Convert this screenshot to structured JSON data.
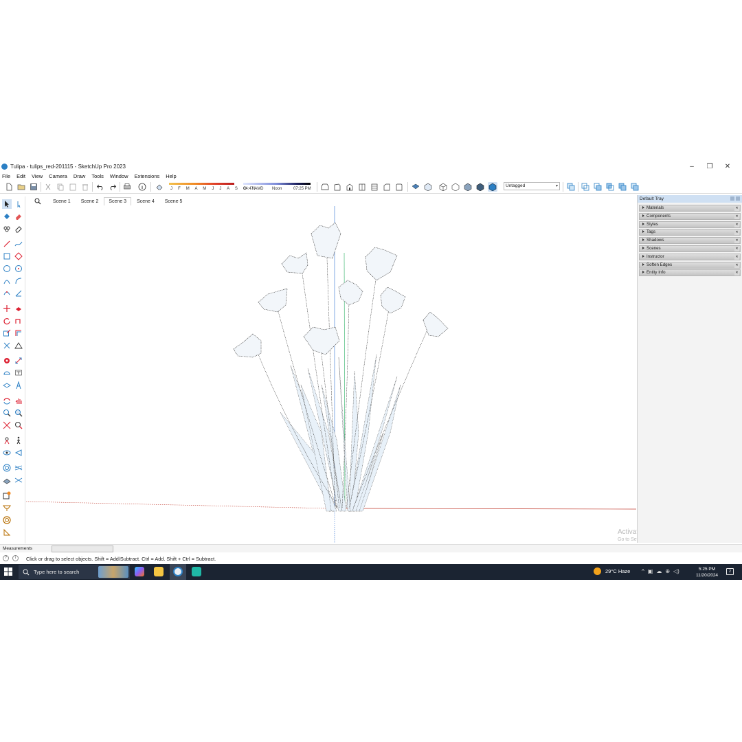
{
  "window": {
    "title": "Tulipa - tulips_red-201115 - SketchUp Pro 2023",
    "controls": [
      "–",
      "❐",
      "✕"
    ]
  },
  "menu": [
    "File",
    "Edit",
    "View",
    "Camera",
    "Draw",
    "Tools",
    "Window",
    "Extensions",
    "Help"
  ],
  "shadow": {
    "months": "J F M A M J J A S O N D",
    "time_start": "04:47 AM",
    "time_mid": "Noon",
    "time_end": "07:25 PM"
  },
  "tag_select": {
    "value": "Untagged"
  },
  "scenes": {
    "tabs": [
      "Scene 1",
      "Scene 2",
      "Scene 3",
      "Scene 4",
      "Scene 5"
    ],
    "active_index": 2
  },
  "tray": {
    "title": "Default Tray",
    "panels": [
      "Materials",
      "Components",
      "Styles",
      "Tags",
      "Shadows",
      "Scenes",
      "Instructor",
      "Soften Edges",
      "Entity Info"
    ]
  },
  "measurements": {
    "label": "Measurements",
    "value": ""
  },
  "status": {
    "message": "Click or drag to select objects. Shift = Add/Subtract. Ctrl = Add. Shift + Ctrl = Subtract."
  },
  "watermark": {
    "line1": "Activate Windows",
    "line2": "Go to Settings to activate Windows."
  },
  "taskbar": {
    "search_placeholder": "Type here to search",
    "weather": "29°C  Haze",
    "time": "5:25 PM",
    "date": "11/20/2024",
    "notification_count": "2"
  },
  "colors": {
    "taskbar": "#1b2432",
    "tray_header": "#cfe0f3",
    "accent_blue": "#2b7fc4",
    "axis_red": "#c0392b",
    "axis_green": "#27ae60",
    "axis_blue": "#2f6fd1"
  },
  "icons": {
    "toolbar": [
      "new-file-icon",
      "open-icon",
      "save-icon",
      "cut-icon",
      "copy-icon",
      "paste-icon",
      "erase-icon",
      "undo-icon",
      "redo-icon",
      "print-icon",
      "model-info-icon",
      "eraser-style-icon",
      "zoom-extents-icon",
      "iso-view-icon",
      "top-view-icon",
      "front-view-icon",
      "right-view-icon",
      "back-view-icon",
      "left-view-icon",
      "xray-icon",
      "back-edges-icon",
      "wireframe-icon",
      "hidden-line-icon",
      "shaded-icon",
      "shaded-textures-icon",
      "monochrome-icon",
      "solid-union-icon",
      "solid-subtract-icon",
      "solid-intersect-icon",
      "solid-trim-icon",
      "solid-split-icon",
      "outer-shell-icon"
    ]
  }
}
